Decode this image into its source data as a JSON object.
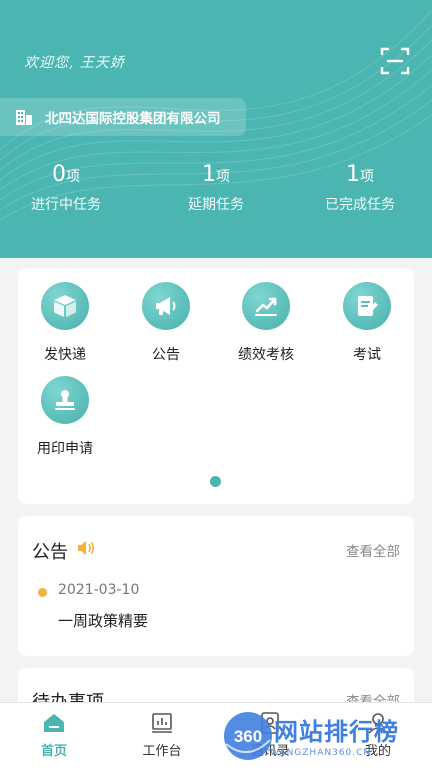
{
  "header": {
    "welcome": "欢迎您, 王天娇",
    "company": "北四达国际控股集团有限公司",
    "stats": [
      {
        "value": "0",
        "unit": "项",
        "label": "进行中任务"
      },
      {
        "value": "1",
        "unit": "项",
        "label": "延期任务"
      },
      {
        "value": "1",
        "unit": "项",
        "label": "已完成任务"
      }
    ],
    "bg_color": "#4bb6b1"
  },
  "apps": [
    {
      "label": "发快递",
      "icon": "package-icon"
    },
    {
      "label": "公告",
      "icon": "megaphone-icon"
    },
    {
      "label": "绩效考核",
      "icon": "chart-icon"
    },
    {
      "label": "考试",
      "icon": "exam-icon"
    },
    {
      "label": "用印申请",
      "icon": "stamp-icon"
    }
  ],
  "notice": {
    "title": "公告",
    "view_all": "查看全部",
    "items": [
      {
        "date": "2021-03-10",
        "text": "一周政策精要"
      }
    ]
  },
  "todo": {
    "title": "待办事项",
    "view_all": "查看全部"
  },
  "tabbar": [
    {
      "label": "首页",
      "icon": "home-icon",
      "active": true
    },
    {
      "label": "工作台",
      "icon": "workbench-icon",
      "active": false
    },
    {
      "label": "通讯录",
      "icon": "contacts-icon",
      "active": false
    },
    {
      "label": "我的",
      "icon": "profile-icon",
      "active": false
    }
  ],
  "watermark": {
    "logo_text": "360",
    "title": "网站排行榜",
    "subtitle": "WANGZHAN360.CN"
  }
}
